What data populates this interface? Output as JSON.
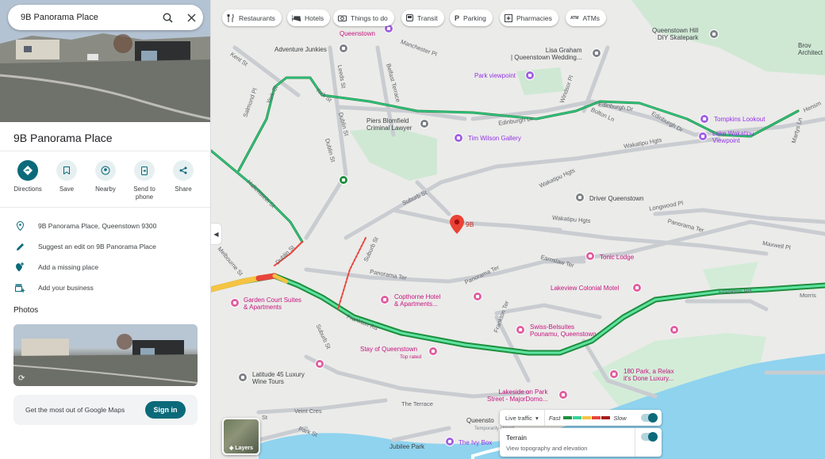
{
  "search": {
    "query": "9B Panorama Place"
  },
  "place": {
    "title": "9B Panorama Place"
  },
  "actions": [
    {
      "label": "Directions"
    },
    {
      "label": "Save"
    },
    {
      "label": "Nearby"
    },
    {
      "label": "Send to phone"
    },
    {
      "label": "Share"
    }
  ],
  "info": {
    "address": "9B Panorama Place, Queenstown 9300",
    "suggest_edit": "Suggest an edit on 9B Panorama Place",
    "add_missing": "Add a missing place",
    "add_business": "Add your business"
  },
  "photos": {
    "heading": "Photos"
  },
  "signin": {
    "text": "Get the most out of Google Maps",
    "button": "Sign in"
  },
  "chips": [
    {
      "label": "Restaurants",
      "icon": "fork-knife-icon"
    },
    {
      "label": "Hotels",
      "icon": "bed-icon"
    },
    {
      "label": "Things to do",
      "icon": "camera-icon"
    },
    {
      "label": "Transit",
      "icon": "bus-icon"
    },
    {
      "label": "Parking",
      "icon": "parking-icon"
    },
    {
      "label": "Pharmacies",
      "icon": "pharmacy-icon"
    },
    {
      "label": "ATMs",
      "icon": "atm-icon"
    }
  ],
  "map": {
    "marker_label": "9B",
    "pois": {
      "queenstown_hill": "Queenstown Hill\nDIY Skatepark",
      "architect": "Brov\nArchitect",
      "adventure_junkies": "Adventure Junkies",
      "lisa_graham": "Lisa Graham\n| Queenstown Wedding...",
      "park_viewpoint": "Park viewpoint",
      "piers_blomfield": "Piers Blomfield\nCriminal Lawyer",
      "tim_wilson": "Tim Wilson Gallery",
      "tompkins": "Tompkins Lookout",
      "lake_wakatipu": "Lake Wakatipu\nViewpoint",
      "driver_queenstown": "Driver Queenstown",
      "tonic_lodge": "Tonic Lodge",
      "lakeview": "Lakeview Colonial Motel",
      "garden_court": "Garden Court Suites\n& Apartments",
      "copthorne": "Copthorne Hotel\n& Apartments...",
      "swiss_belsuites": "Swiss-Belsuites\nPounamu, Queenstown",
      "stay_qt": "Stay of Queenstown",
      "stay_qt_sub": "Top rated",
      "latitude45": "Latitude 45 Luxury\nWine Tours",
      "relax180": "180 Park, a Relax\nit's Done Luxury...",
      "lakeside_park": "Lakeside on Park\nStreet - MajorDomo...",
      "ivy_box": "The Ivy Box",
      "jubilee": "Jubilee Park",
      "queenstown_top": "Queenstown",
      "queenstown_temp": "Queensto",
      "temp_sub": "Temporarily closed"
    },
    "streets": {
      "kent": "Kent St",
      "salmond": "Salmond Pl",
      "york": "York St",
      "leeds": "Leeds St",
      "belfast": "Belfast Terrace",
      "manchester": "Manchester Pl",
      "dublin1": "Dublin St",
      "dublin2": "Dublin St",
      "dublin3": "Dublin St",
      "edinburgh1": "Edinburgh Dr",
      "edinburgh2": "Edinburgh Dr",
      "edinburgh3": "Edinburgh Dr",
      "bolton": "Bolton Ln",
      "windsor": "Windsor Pl",
      "wakatipu1": "Wakatipu Hgts",
      "wakatipu2": "Wakatipu Hgts",
      "wakatipu3": "Wakatipu Hgts",
      "hallenstein": "Hallenstein St",
      "suburb1": "Suburb St",
      "suburb2": "Suburb St",
      "suburb3": "Suburb St",
      "panorama1": "Panorama Ter",
      "panorama2": "Panorama Ter",
      "panorama3": "Panorama Ter",
      "longwood": "Longwood Pl",
      "earnslaw": "Earnslaw Ter",
      "maxwell": "Maxwell Pl",
      "melbourne": "Melbourne St",
      "frankton1": "Frankton Rd",
      "frankton2": "Frankton Rd",
      "frankton_ter": "Frankton Ter",
      "morris": "Morris",
      "terrace": "The Terrace",
      "veint": "Veint Cres",
      "park": "Park St",
      "marlys": "Martys Ln",
      "hensman": "Hensm",
      "st": "St"
    }
  },
  "layers": {
    "label": "Layers"
  },
  "traffic": {
    "label": "Live traffic",
    "fast": "Fast",
    "slow": "Slow",
    "colors": [
      "#1e8e3e",
      "#34d399",
      "#f6c343",
      "#e8453c",
      "#a51d1d"
    ]
  },
  "terrain": {
    "title": "Terrain",
    "subtitle": "View topography and elevation"
  }
}
